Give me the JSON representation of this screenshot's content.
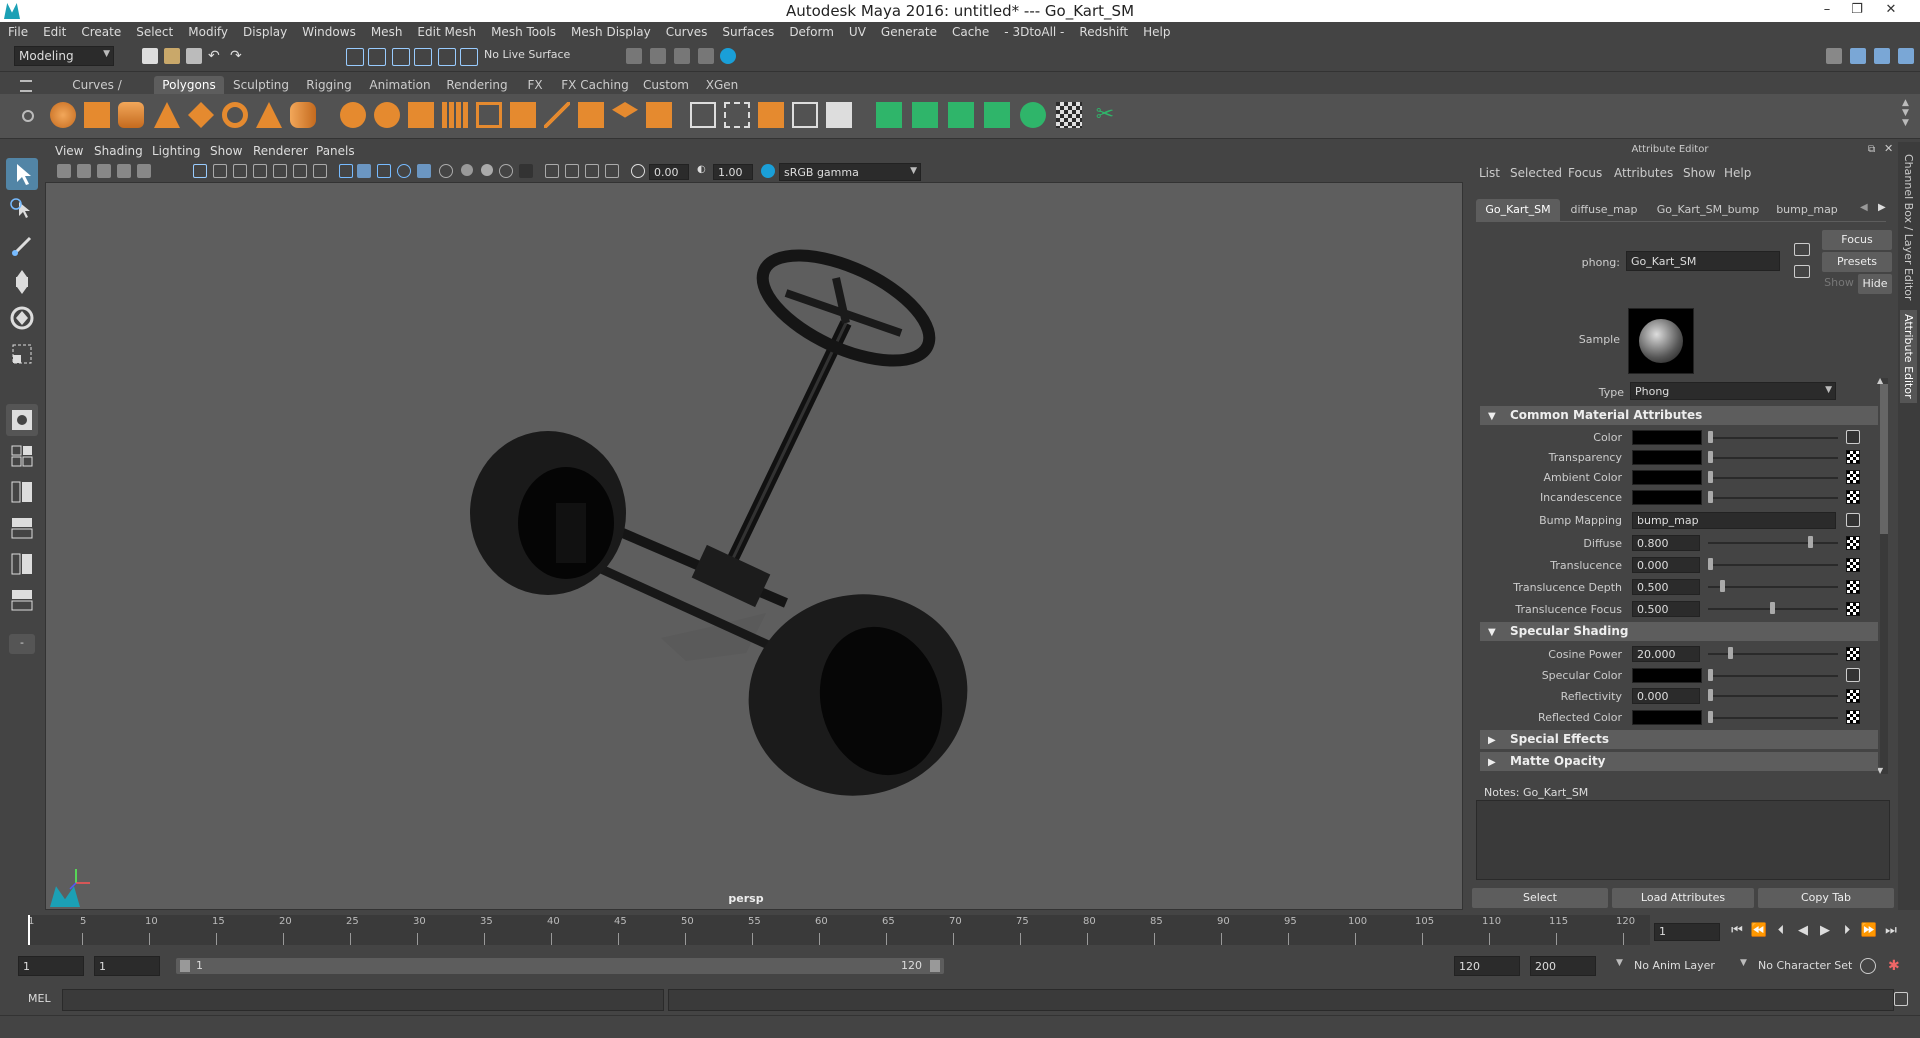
{
  "window": {
    "title": "Autodesk Maya 2016: untitled*   ---   Go_Kart_SM",
    "min": "–",
    "restore": "❐",
    "close": "✕"
  },
  "menubar": [
    "File",
    "Edit",
    "Create",
    "Select",
    "Modify",
    "Display",
    "Windows",
    "Mesh",
    "Edit Mesh",
    "Mesh Tools",
    "Mesh Display",
    "Curves",
    "Surfaces",
    "Deform",
    "UV",
    "Generate",
    "Cache",
    "- 3DtoAll -",
    "Redshift",
    "Help"
  ],
  "statusline": {
    "mode": "Modeling",
    "live_surface": "No Live Surface"
  },
  "shelf": {
    "tabs": [
      "Curves / Surfaces",
      "Polygons",
      "Sculpting",
      "Rigging",
      "Animation",
      "Rendering",
      "FX",
      "FX Caching",
      "Custom",
      "XGen"
    ],
    "active_tab": "Polygons"
  },
  "viewport": {
    "menus": [
      "View",
      "Shading",
      "Lighting",
      "Show",
      "Renderer",
      "Panels"
    ],
    "exposure": "0.00",
    "gamma": "1.00",
    "colorspace": "sRGB gamma",
    "camera_label": "persp"
  },
  "attribute_editor": {
    "title": "Attribute Editor",
    "menus": [
      "List",
      "Selected",
      "Focus",
      "Attributes",
      "Show",
      "Help"
    ],
    "tabs": [
      "Go_Kart_SM",
      "diffuse_map",
      "Go_Kart_SM_bump",
      "bump_map"
    ],
    "active_tab": "Go_Kart_SM",
    "focus_btn": "Focus",
    "presets_btn": "Presets",
    "show_btn": "Show",
    "hide_btn": "Hide",
    "node_label": "phong:",
    "node_name": "Go_Kart_SM",
    "sample_label": "Sample",
    "type_label": "Type",
    "type_value": "Phong",
    "sections": {
      "common": "Common Material Attributes",
      "specular": "Specular Shading",
      "special": "Special Effects",
      "matte": "Matte Opacity"
    },
    "common_attrs": {
      "color": "Color",
      "transparency": "Transparency",
      "ambient": "Ambient Color",
      "incandescence": "Incandescence",
      "bump_label": "Bump Mapping",
      "bump_value": "bump_map",
      "diffuse_label": "Diffuse",
      "diffuse_value": "0.800",
      "translucence_label": "Translucence",
      "translucence_value": "0.000",
      "tdepth_label": "Translucence Depth",
      "tdepth_value": "0.500",
      "tfocus_label": "Translucence Focus",
      "tfocus_value": "0.500"
    },
    "specular_attrs": {
      "cosine_label": "Cosine Power",
      "cosine_value": "20.000",
      "speccolor_label": "Specular Color",
      "reflectivity_label": "Reflectivity",
      "reflectivity_value": "0.000",
      "reflcolor_label": "Reflected Color"
    },
    "notes": "Notes:  Go_Kart_SM",
    "buttons": {
      "select": "Select",
      "load": "Load Attributes",
      "copy": "Copy Tab"
    }
  },
  "sidetabs": {
    "channel": "Channel Box / Layer Editor",
    "attr": "Attribute Editor"
  },
  "timeline": {
    "ticks": [
      "5",
      "10",
      "15",
      "20",
      "25",
      "30",
      "35",
      "40",
      "45",
      "50",
      "55",
      "60",
      "65",
      "70",
      "75",
      "80",
      "85",
      "90",
      "95",
      "100",
      "105",
      "110",
      "115",
      "120"
    ],
    "start_tick": "1",
    "current_frame": "1"
  },
  "range": {
    "start": "1",
    "playback_start": "1",
    "slider_start": "1",
    "slider_end": "120",
    "playback_end": "120",
    "end": "200",
    "anim_layer": "No Anim Layer",
    "char_set": "No Character Set"
  },
  "cmdline": {
    "label": "MEL"
  }
}
